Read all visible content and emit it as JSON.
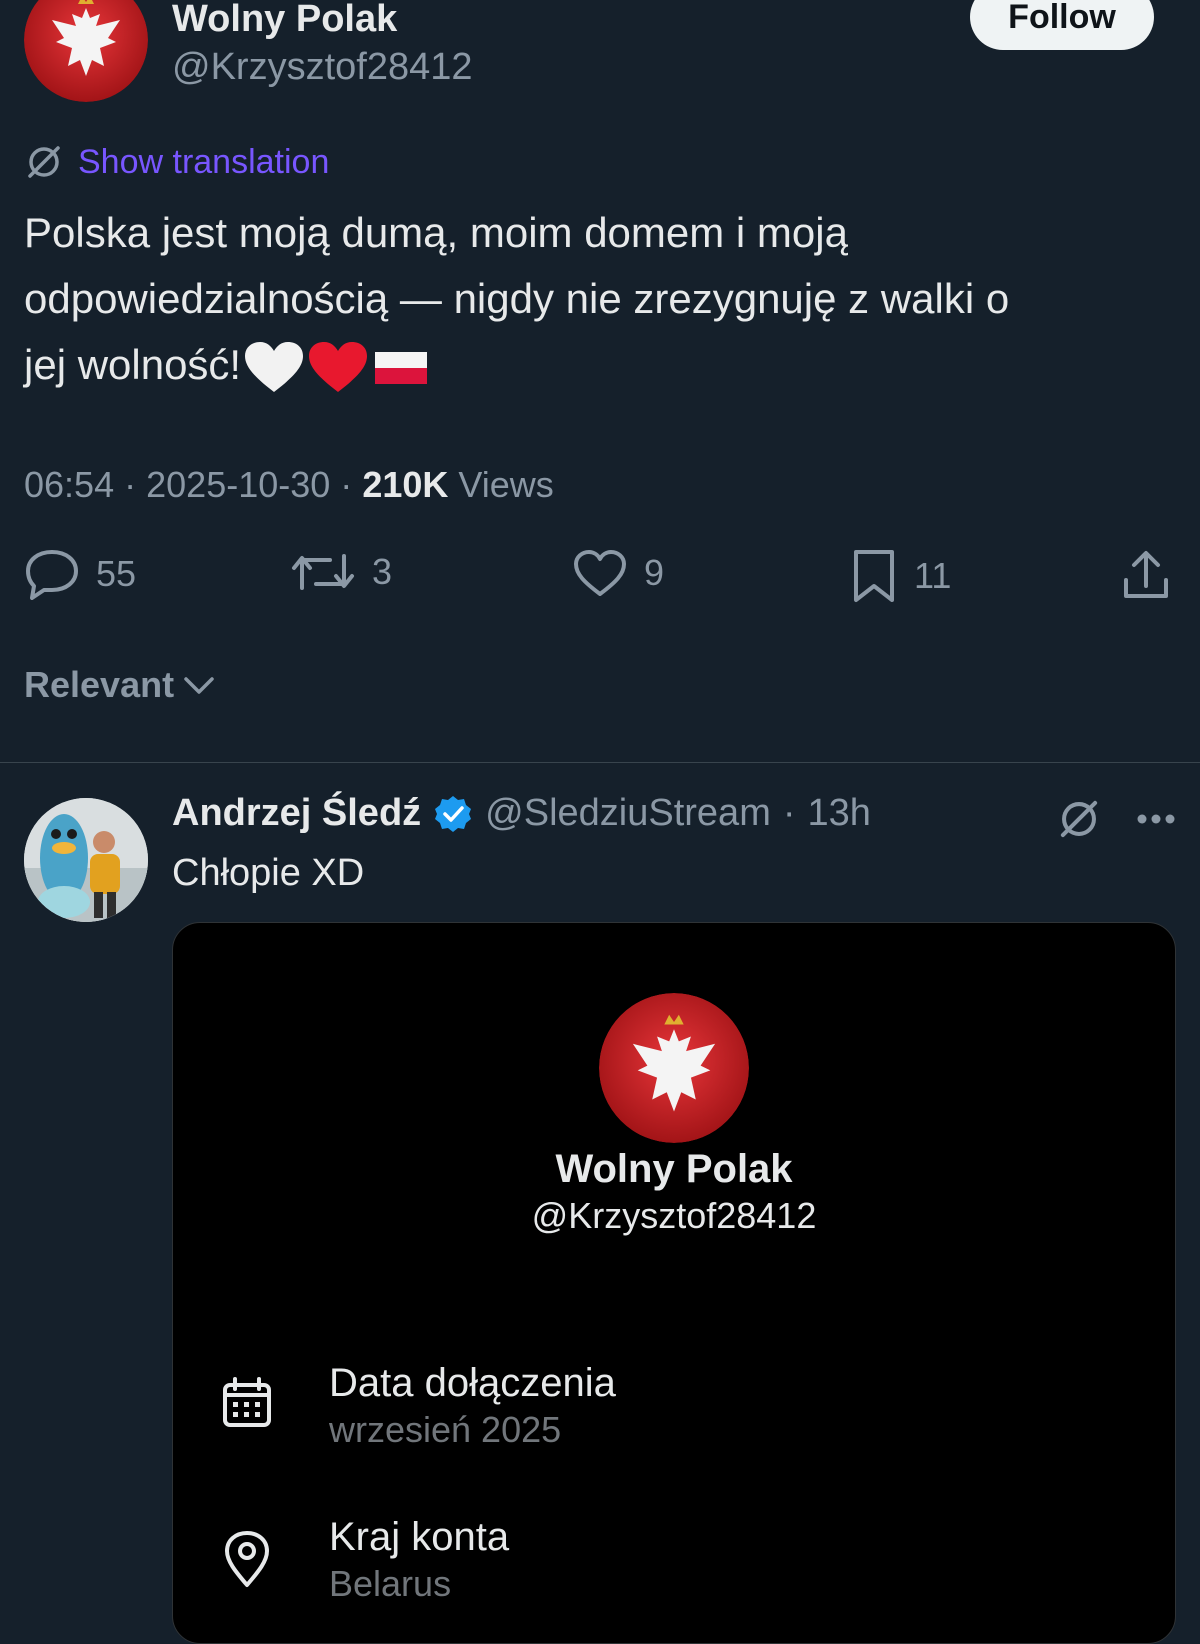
{
  "tweet": {
    "author_name": "Wolny Polak",
    "author_handle": "@Krzysztof28412",
    "follow_label": "Follow",
    "show_translation": "Show translation",
    "text_line1": "Polska jest moją dumą, moim domem i moją",
    "text_line2": "odpowiedzialnością — nigdy nie zrezygnuję z walki o",
    "text_line3": "jej wolność!",
    "time": "06:54",
    "date": "2025-10-30",
    "views_count": "210K",
    "views_label": "Views",
    "separator": "·",
    "replies": "55",
    "reposts": "3",
    "likes": "9",
    "bookmarks": "11"
  },
  "sort": {
    "label": "Relevant"
  },
  "reply": {
    "author_name": "Andrzej Śledź",
    "author_handle": "@SledziuStream",
    "age": "13h",
    "separator": "·",
    "text": "Chłopie XD"
  },
  "card": {
    "name": "Wolny Polak",
    "handle": "@Krzysztof28412",
    "joined_label": "Data dołączenia",
    "joined_value": "wrzesień 2025",
    "country_label": "Kraj konta",
    "country_value": "Belarus"
  },
  "colors": {
    "background": "#15202b",
    "card_background": "#000000",
    "translation_link": "#7856ff",
    "verified_badge": "#1d9bf0",
    "muted_text": "#8b98a5"
  },
  "icons": [
    "polish-eagle-avatar",
    "translate-icon",
    "white-heart-emoji",
    "red-heart-emoji",
    "poland-flag-emoji",
    "reply-icon",
    "repost-icon",
    "like-icon",
    "bookmark-icon",
    "share-icon",
    "chevron-down-icon",
    "verified-badge-icon",
    "more-icon",
    "calendar-icon",
    "location-pin-icon"
  ]
}
